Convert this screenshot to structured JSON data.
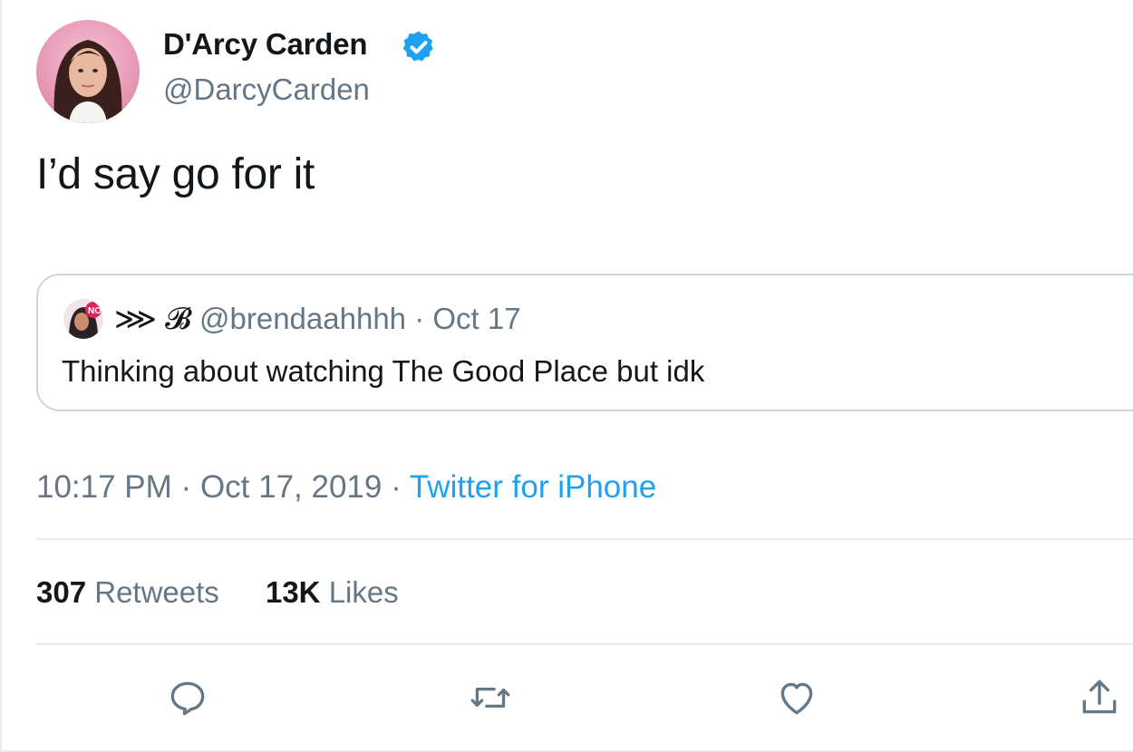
{
  "tweet": {
    "author": {
      "display_name": "D'Arcy Carden",
      "handle": "@DarcyCarden",
      "verified": true,
      "avatar_icon": "profile-photo"
    },
    "text": "I’d say go for it",
    "quoted_tweet": {
      "author_emoji_name": "⋙ 𝓑",
      "handle": "@brendaahhhh",
      "separator": "·",
      "date": "Oct 17",
      "text": "Thinking about watching The Good Place but idk"
    },
    "timestamp": {
      "time": "10:17 PM",
      "separator1": "·",
      "date": "Oct 17, 2019",
      "separator2": "·",
      "source": "Twitter for iPhone"
    },
    "stats": {
      "retweets_count": "307",
      "retweets_label": "Retweets",
      "likes_count": "13K",
      "likes_label": "Likes"
    },
    "actions": [
      {
        "icon": "reply-icon"
      },
      {
        "icon": "retweet-icon"
      },
      {
        "icon": "like-icon"
      },
      {
        "icon": "share-icon"
      }
    ]
  },
  "colors": {
    "primary_text": "#14171a",
    "secondary_text": "#657786",
    "link": "#1da1f2",
    "verified": "#1da1f2",
    "border": "#ccd6dd",
    "divider": "#e6ecf0"
  }
}
